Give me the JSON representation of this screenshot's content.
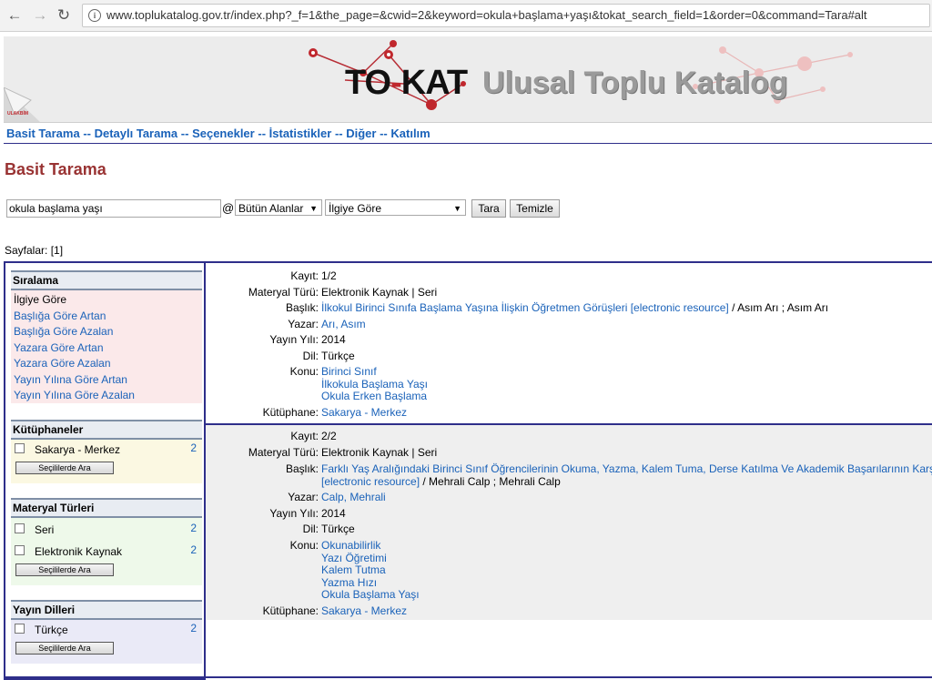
{
  "browser": {
    "url": "www.toplukatalog.gov.tr/index.php?_f=1&the_page=&cwid=2&keyword=okula+başlama+yaşı&tokat_search_field=1&order=0&command=Tara#alt"
  },
  "banner": {
    "logo_main": "TO-KAT",
    "logo_sub": "Ulusal Toplu Katalog",
    "corner_text": "ULAKBİM"
  },
  "menu": {
    "items": [
      "Basit Tarama",
      "Detaylı Tarama",
      "Seçenekler",
      "İstatistikler",
      "Diğer",
      "Katılım"
    ],
    "separator": "--"
  },
  "page_title": "Basit Tarama",
  "search": {
    "keyword": "okula başlama yaşı",
    "at": "@",
    "field": "Bütün Alanlar",
    "order": "İlgiye Göre",
    "search_button": "Tara",
    "clear_button": "Temizle"
  },
  "pages": {
    "label": "Sayfalar:",
    "value": "[1]"
  },
  "sidebar": {
    "sorting": {
      "title": "Sıralama",
      "active": "İlgiye Göre",
      "items": [
        "Başlığa Göre Artan",
        "Başlığa Göre Azalan",
        "Yazara Göre Artan",
        "Yazara Göre Azalan",
        "Yayın Yılına Göre Artan",
        "Yayın Yılına Göre Azalan"
      ]
    },
    "libraries": {
      "title": "Kütüphaneler",
      "items": [
        {
          "label": "Sakarya - Merkez",
          "count": "2"
        }
      ],
      "button": "Seçililerde Ara"
    },
    "material_types": {
      "title": "Materyal Türleri",
      "items": [
        {
          "label": "Seri",
          "count": "2"
        },
        {
          "label": "Elektronik Kaynak",
          "count": "2"
        }
      ],
      "button": "Seçililerde Ara"
    },
    "languages": {
      "title": "Yayın Dilleri",
      "items": [
        {
          "label": "Türkçe",
          "count": "2"
        }
      ],
      "button": "Seçililerde Ara"
    }
  },
  "labels": {
    "record": "Kayıt:",
    "material_type": "Materyal Türü:",
    "title": "Başlık:",
    "author": "Yazar:",
    "year": "Yayın Yılı:",
    "language": "Dil:",
    "subject": "Konu:",
    "library": "Kütüphane:"
  },
  "records": [
    {
      "record": "1/2",
      "material_type": "Elektronik Kaynak | Seri",
      "title_link": "İlkokul Birinci Sınıfa Başlama Yaşına İlişkin Öğretmen Görüşleri [electronic resource]",
      "title_rest": " / Asım Arı ; Asım Arı",
      "author": "Arı, Asım",
      "year": "2014",
      "language": "Türkçe",
      "subjects": [
        "Birinci Sınıf",
        "İlkokula Başlama Yaşı",
        "Okula Erken Başlama"
      ],
      "library": "Sakarya - Merkez"
    },
    {
      "record": "2/2",
      "material_type": "Elektronik Kaynak | Seri",
      "title_link_line1": "Farklı Yaş Aralığındaki Birinci Sınıf Öğrencilerinin Okuma, Yazma, Kalem Tuma, Derse Katılma Ve Akademik Başarılarının Karşıla",
      "title_link_line2": "[electronic resource]",
      "title_rest": " / Mehrali Calp ; Mehrali Calp",
      "author": "Calp, Mehrali",
      "year": "2014",
      "language": "Türkçe",
      "subjects": [
        "Okunabilirlik",
        "Yazı Öğretimi",
        "Kalem Tutma",
        "Yazma Hızı",
        "Okula Başlama Yaşı"
      ],
      "library": "Sakarya - Merkez"
    }
  ],
  "colors": {
    "link": "#1a62b9",
    "title_red": "#993333",
    "border_navy": "#2e2e8a",
    "sort_panel_bg": "#fbe9ea",
    "library_panel_bg": "#fbf8e2",
    "material_panel_bg": "#eef9ea",
    "language_panel_bg": "#eaeaf7",
    "record2_bg": "#efefef"
  }
}
